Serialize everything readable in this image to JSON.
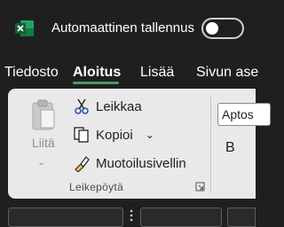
{
  "titlebar": {
    "app_icon": "excel-icon",
    "autosave_label": "Automaattinen tallennus",
    "autosave_state": "off"
  },
  "tabs": [
    {
      "label": "Tiedosto",
      "active": false
    },
    {
      "label": "Aloitus",
      "active": true
    },
    {
      "label": "Lisää",
      "active": false
    },
    {
      "label": "Sivun ase",
      "active": false
    }
  ],
  "ribbon": {
    "paste_label": "Liitä",
    "cut_label": "Leikkaa",
    "copy_label": "Kopioi",
    "format_painter_label": "Muotoilusivellin",
    "clipboard_group_label": "Leikepöytä",
    "font_name": "Aptos",
    "bold_label": "B"
  },
  "icons": {
    "paste": "clipboard-icon",
    "cut": "scissors-icon",
    "copy": "copy-icon",
    "format_painter": "paintbrush-icon",
    "launcher": "dialog-launcher-icon"
  },
  "colors": {
    "excel_green": "#1e7145",
    "tab_underline": "#4a9a5c",
    "ribbon_bg": "#e9e9e9",
    "titlebar_bg": "#1f1f1f"
  }
}
